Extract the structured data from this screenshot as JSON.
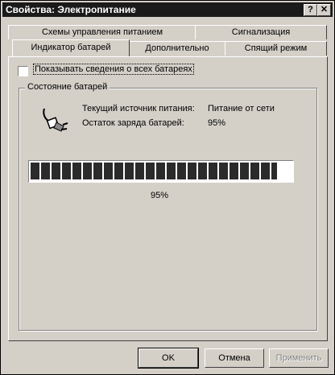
{
  "window": {
    "title": "Свойства: Электропитание",
    "help_label": "?",
    "close_label": "✕"
  },
  "tabs": {
    "row_back": [
      {
        "label": "Схемы управления питанием"
      },
      {
        "label": "Сигнализация"
      }
    ],
    "row_front": [
      {
        "label": "Индикатор батарей",
        "active": true
      },
      {
        "label": "Дополнительно"
      },
      {
        "label": "Спящий режим"
      }
    ]
  },
  "options": {
    "show_all_batteries_label": "Показывать сведения о всех батареях",
    "show_all_batteries_checked": false
  },
  "battery_status": {
    "group_title": "Состояние батарей",
    "source_label": "Текущий источник питания:",
    "source_value": "Питание от сети",
    "charge_label": "Остаток заряда батарей:",
    "charge_value": "95%",
    "progress_text": "95%",
    "progress_fraction": 0.95,
    "icon": "power-plug-icon"
  },
  "buttons": {
    "ok": "OK",
    "cancel": "Отмена",
    "apply": "Применить"
  }
}
